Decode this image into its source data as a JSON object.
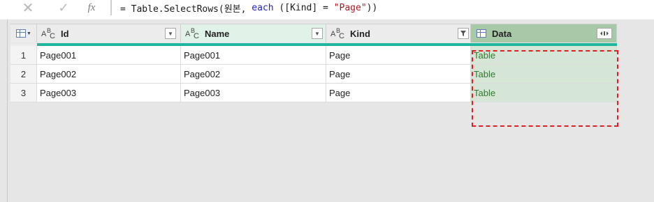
{
  "formula_bar": {
    "cancel_glyph": "✕",
    "commit_glyph": "✓",
    "fx_label": "fx",
    "formula_parts": {
      "prefix": "= Table.SelectRows(원본, ",
      "keyword": "each",
      "middle": " ([Kind] = ",
      "string": "\"Page\"",
      "suffix": "))"
    }
  },
  "columns": [
    {
      "name": "Id",
      "type": "text",
      "filter_icon": "dropdown-arrow-icon"
    },
    {
      "name": "Name",
      "type": "text",
      "filter_icon": "dropdown-arrow-icon"
    },
    {
      "name": "Kind",
      "type": "text",
      "filter_icon": "filter-applied-icon"
    },
    {
      "name": "Data",
      "type": "table",
      "filter_icon": "expand-column-icon"
    }
  ],
  "rows": [
    {
      "num": "1",
      "Id": "Page001",
      "Name": "Page001",
      "Kind": "Page",
      "Data": "Table"
    },
    {
      "num": "2",
      "Id": "Page002",
      "Name": "Page002",
      "Kind": "Page",
      "Data": "Table"
    },
    {
      "num": "3",
      "Id": "Page003",
      "Name": "Page003",
      "Kind": "Page",
      "Data": "Table"
    }
  ],
  "colors": {
    "accent_bar": "#1db79f",
    "selected_header": "#a8c9a8",
    "selected_cells": "#d6e6d6",
    "table_text": "#2e7a2e",
    "highlight_border": "#e02020"
  }
}
